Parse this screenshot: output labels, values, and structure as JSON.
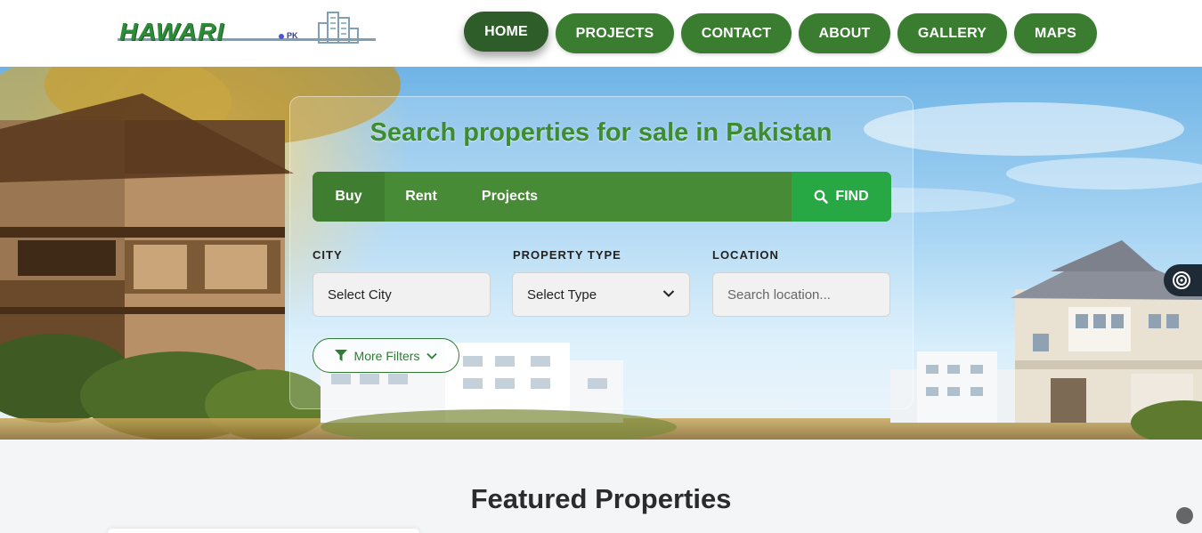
{
  "brand": {
    "name": "HAWARI",
    "suffix": "PK"
  },
  "nav": {
    "items": [
      {
        "label": "HOME",
        "active": true
      },
      {
        "label": "PROJECTS",
        "active": false
      },
      {
        "label": "CONTACT",
        "active": false
      },
      {
        "label": "ABOUT",
        "active": false
      },
      {
        "label": "GALLERY",
        "active": false
      },
      {
        "label": "MAPS",
        "active": false
      }
    ]
  },
  "hero": {
    "title": "Search properties for sale in Pakistan",
    "tabs": [
      {
        "label": "Buy",
        "active": true
      },
      {
        "label": "Rent",
        "active": false
      },
      {
        "label": "Projects",
        "active": false
      }
    ],
    "find_label": "FIND",
    "find_icon": "search-icon",
    "filters": {
      "city": {
        "label": "CITY",
        "value": "Select City"
      },
      "property_type": {
        "label": "PROPERTY TYPE",
        "value": "Select Type"
      },
      "location": {
        "label": "LOCATION",
        "placeholder": "Search location..."
      }
    },
    "more_filters_label": "More Filters"
  },
  "featured": {
    "title": "Featured Properties"
  },
  "accessibility_icon": "accessibility-icon",
  "colors": {
    "primary_green": "#3a7d30",
    "active_green": "#2f5d2a",
    "find_green": "#28a745",
    "title_green": "#3d8c2f"
  }
}
